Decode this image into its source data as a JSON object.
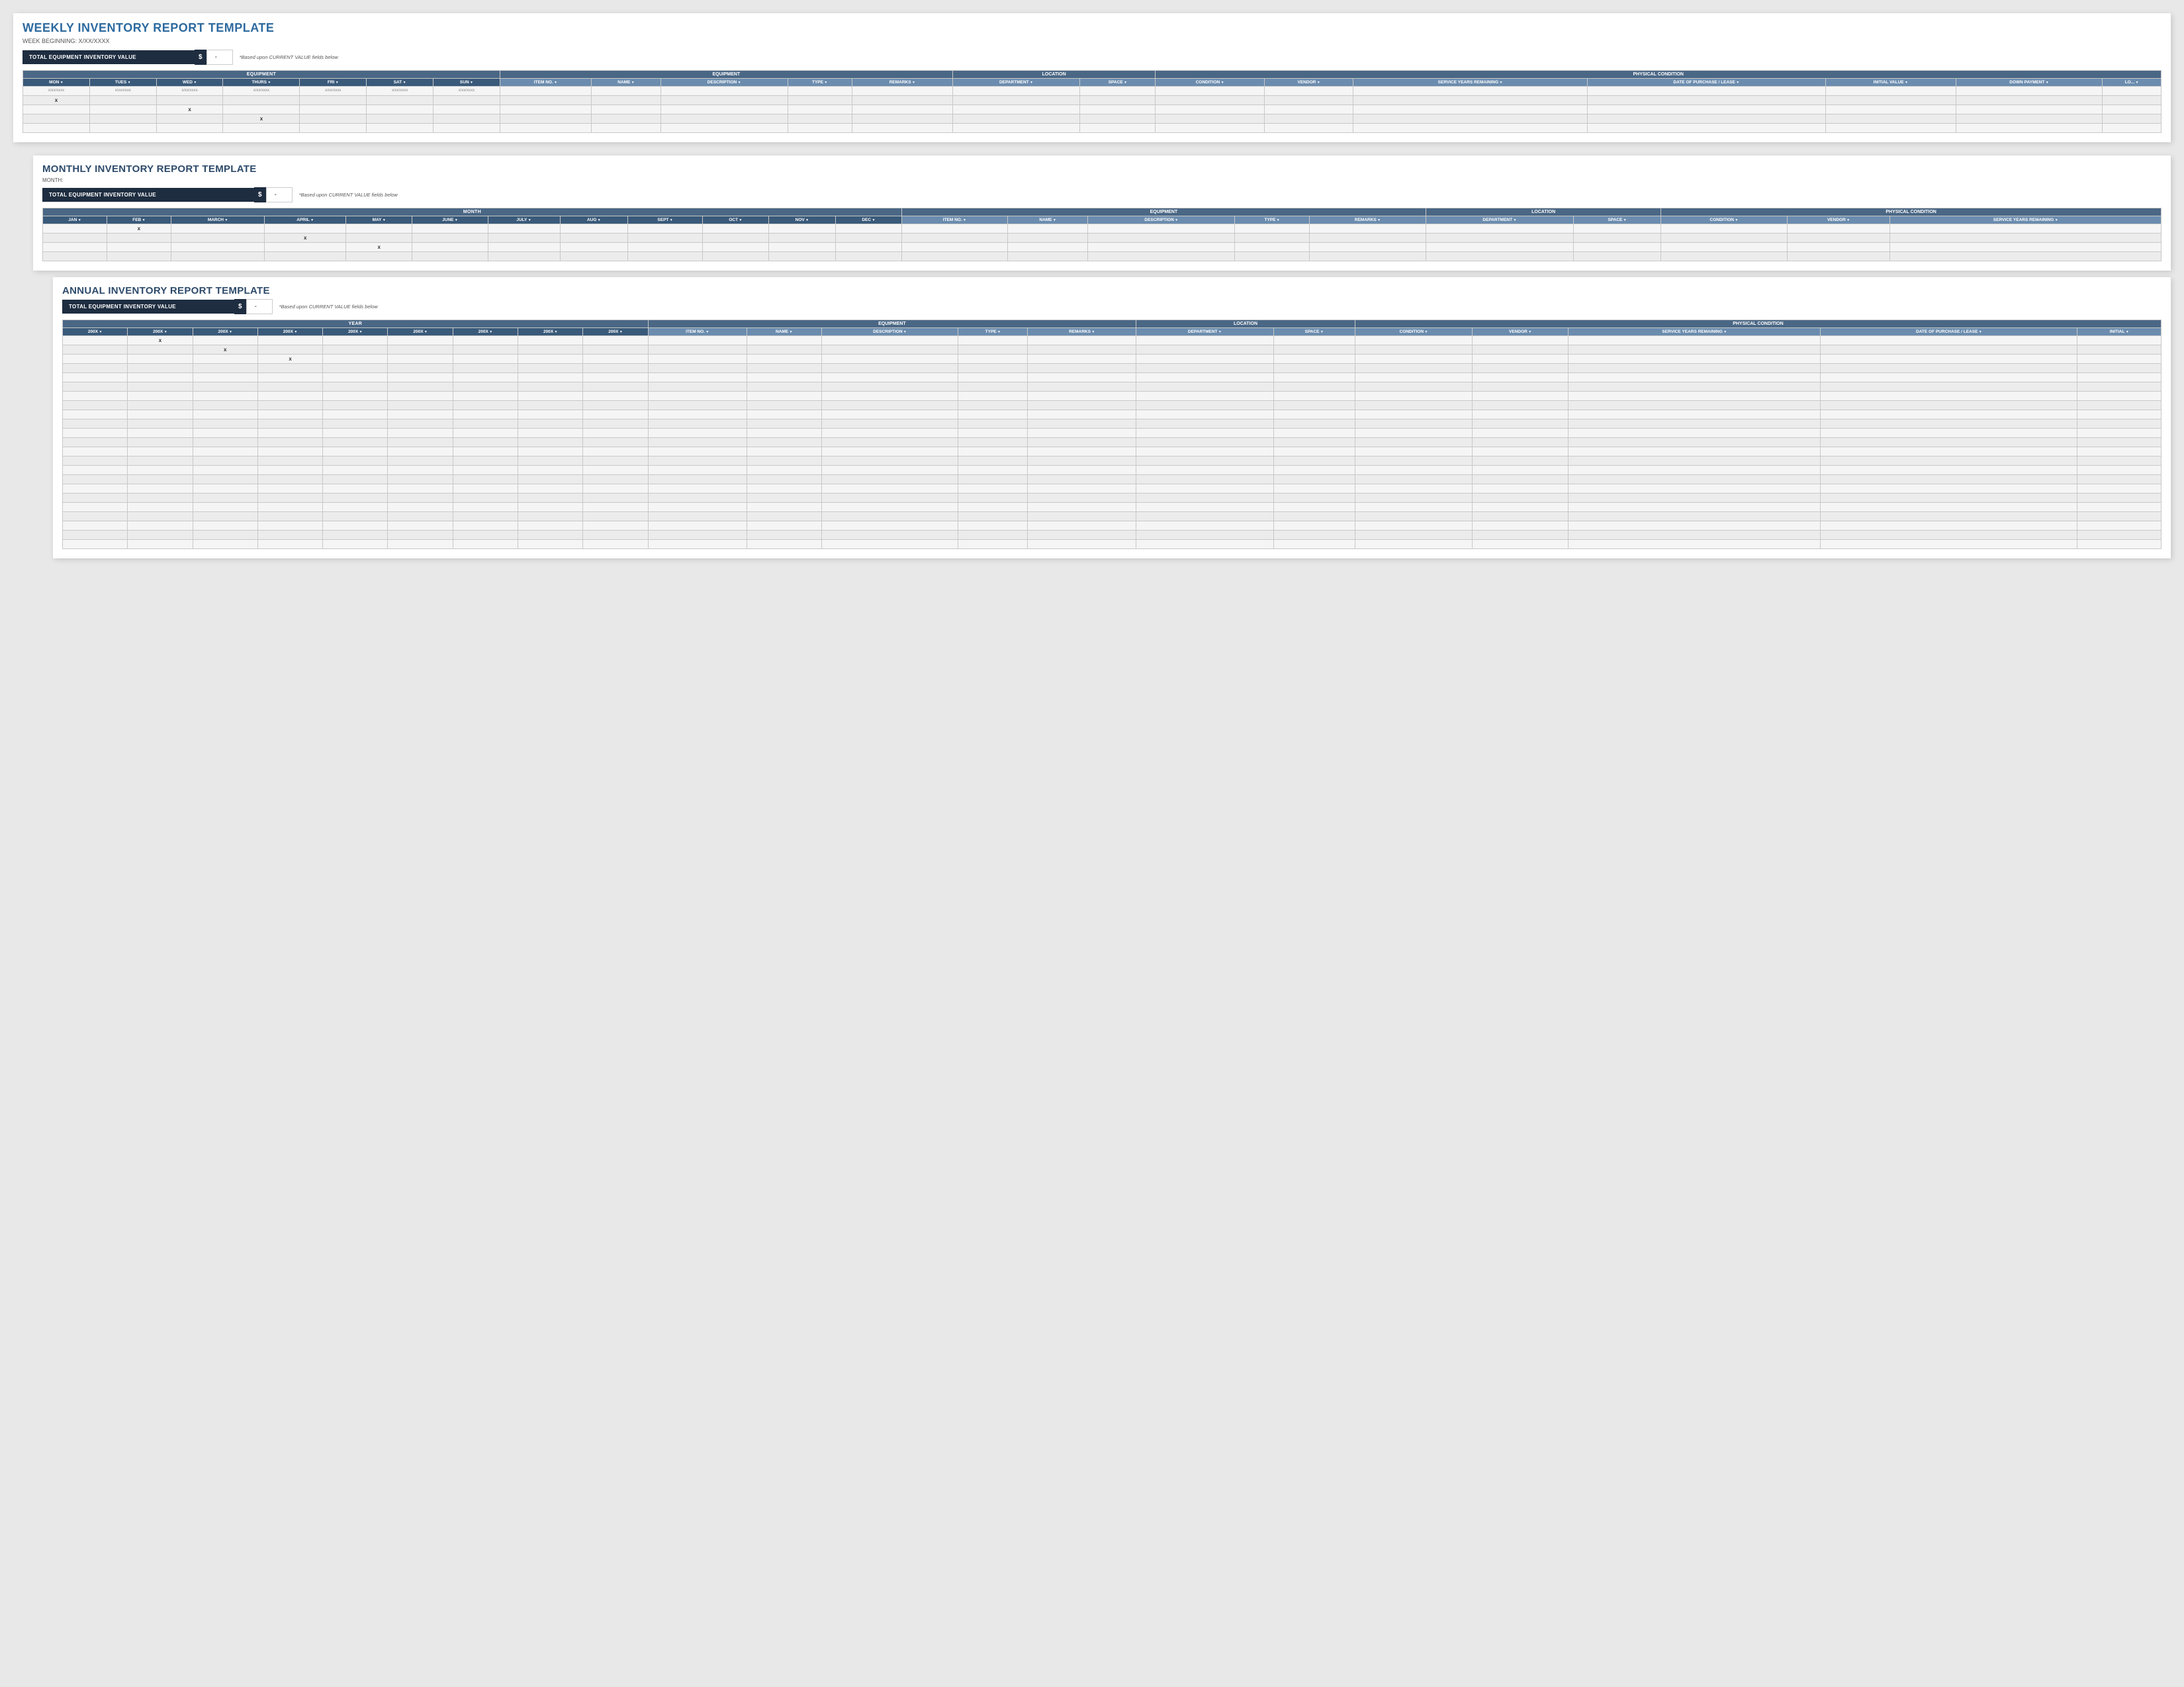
{
  "weekly": {
    "title": "WEEKLY INVENTORY REPORT TEMPLATE",
    "week_label": "WEEK BEGINNING: X/XX/XXXX",
    "total_label": "TOTAL EQUIPMENT INVENTORY VALUE",
    "dollar": "$",
    "dash": "-",
    "note": "*Based upon CURRENT VALUE fields below",
    "period_header": "EQUIPMENT",
    "days": [
      "MON",
      "TUES",
      "WED",
      "THURS",
      "FRI",
      "SAT",
      "SUN"
    ],
    "equipment_header": "EQUIPMENT",
    "location_header": "LOCATION",
    "physical_header": "PHYSICAL CONDITION",
    "columns": {
      "period_sub": [
        "MON",
        "TUES",
        "WED",
        "THURS",
        "FRI",
        "SAT",
        "SUN"
      ],
      "equipment_sub": [
        "ITEM NO.",
        "NAME",
        "DESCRIPTION",
        "TYPE",
        "REMARKS"
      ],
      "location_sub": [
        "DEPARTMENT",
        "SPACE"
      ],
      "physical_sub": [
        "CONDITION",
        "VENDOR",
        "SERVICE YEARS REMAINING",
        "DATE OF PURCHASE / LEASE",
        "INITIAL VALUE",
        "DOWN PAYMENT",
        "LO..."
      ]
    },
    "sample_rows": [
      {
        "day1": "x/xx/xxxx",
        "day2": "x/xx/xxxx",
        "day3": "x/xx/xxxx",
        "day4": "x/xx/xxxx",
        "day5": "x/xx/xxxx",
        "day6": "x/xx/xxxx",
        "day7": "x/xx/xxxx",
        "x_marks": [
          0
        ]
      },
      {
        "x_marks": [
          2
        ]
      },
      {
        "x_marks": [
          3
        ]
      }
    ]
  },
  "monthly": {
    "title": "MONTHLY INVENTORY REPORT TEMPLATE",
    "month_label": "MONTH:",
    "total_label": "TOTAL EQUIPMENT INVENTORY VALUE",
    "dollar": "$",
    "dash": "-",
    "note": "*Based upon CURRENT VALUE fields below",
    "period_header": "MONTH",
    "months": [
      "JAN",
      "FEB",
      "MARCH",
      "APRIL",
      "MAY",
      "JUNE",
      "JULY",
      "AUG",
      "SEPT",
      "OCT",
      "NOV",
      "DEC"
    ],
    "equipment_header": "EQUIPMENT",
    "location_header": "LOCATION",
    "physical_header": "PHYSICAL CONDITION",
    "equipment_cols": [
      "ITEM NO.",
      "NAME",
      "DESCRIPTION",
      "TYPE",
      "REMARKS"
    ],
    "location_cols": [
      "DEPARTMENT",
      "SPACE"
    ],
    "physical_cols": [
      "CONDITION",
      "VENDOR",
      "SERVICE YEARS REMAINING"
    ],
    "sample_rows": [
      {
        "x_marks": [
          1
        ]
      },
      {
        "x_marks": [
          3
        ]
      },
      {
        "x_marks": [
          4
        ]
      }
    ]
  },
  "annual": {
    "title": "ANNUAL INVENTORY REPORT TEMPLATE",
    "total_label": "TOTAL EQUIPMENT INVENTORY VALUE",
    "dollar": "$",
    "dash": "-",
    "note": "*Based upon CURRENT VALUE fields below",
    "period_header": "YEAR",
    "years": [
      "200X",
      "200X",
      "200X",
      "200X",
      "200X",
      "200X",
      "200X",
      "200X",
      "200X"
    ],
    "equipment_header": "EQUIPMENT",
    "location_header": "LOCATION",
    "physical_header": "PHYSICAL CONDITION",
    "equipment_cols": [
      "ITEM NO.",
      "NAME",
      "DESCRIPTION",
      "TYPE",
      "REMARKS"
    ],
    "location_cols": [
      "DEPARTMENT",
      "SPACE"
    ],
    "physical_cols": [
      "CONDITION",
      "VENDOR",
      "SERVICE YEARS REMAINING",
      "DATE OF PURCHASE / LEASE",
      "INITIAL"
    ],
    "sample_rows": [
      {
        "x_marks": [
          1
        ]
      },
      {
        "x_marks": [
          2
        ]
      },
      {
        "x_marks": [
          3
        ]
      }
    ]
  }
}
